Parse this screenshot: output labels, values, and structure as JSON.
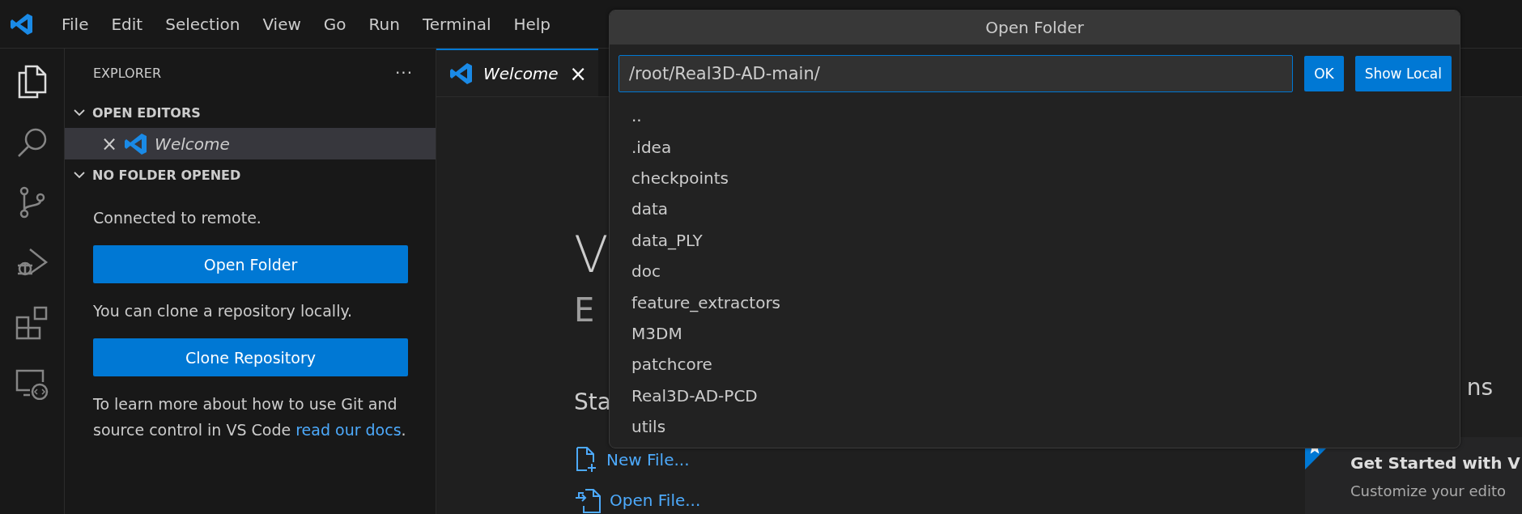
{
  "menu_bar": {
    "items": [
      "File",
      "Edit",
      "Selection",
      "View",
      "Go",
      "Run",
      "Terminal",
      "Help"
    ]
  },
  "activity_bar": {
    "items": [
      {
        "kind": "files",
        "selected": true
      },
      {
        "kind": "search",
        "selected": false
      },
      {
        "kind": "source-control",
        "selected": false
      },
      {
        "kind": "run-debug",
        "selected": false
      },
      {
        "kind": "extensions",
        "selected": false
      },
      {
        "kind": "remote",
        "selected": false
      }
    ]
  },
  "sidebar": {
    "title": "EXPLORER",
    "more": "···",
    "sections": [
      {
        "title": "OPEN EDITORS",
        "expanded": true,
        "items": [
          {
            "close": "×",
            "label": "Welcome",
            "selected": true
          }
        ]
      },
      {
        "title": "NO FOLDER OPENED",
        "expanded": true
      }
    ],
    "message_1": "Connected to remote.",
    "button_1": "Open Folder",
    "message_2": "You can clone a repository locally.",
    "button_2": "Clone Repository",
    "message_3": "To learn more about how to use Git and source control in VS Code ",
    "link": "read our docs",
    "message_3_end": "."
  },
  "tabs": [
    {
      "label": "Welcome",
      "close": "×",
      "selected": true
    }
  ],
  "welcome": {
    "title": "V",
    "subtitle": "E",
    "start_heading": "Sta",
    "right_heading": "ns",
    "actions": [
      {
        "kind": "new-file",
        "label": "New File..."
      },
      {
        "kind": "open-file",
        "label": "Open File..."
      }
    ]
  },
  "notification": {
    "title": "Get Started with V",
    "subtitle": "Customize your edito"
  },
  "dialog": {
    "title": "Open Folder",
    "path": "/root/Real3D-AD-main/",
    "buttons": [
      "OK",
      "Show Local"
    ],
    "entries": [
      "..",
      ".idea",
      "checkpoints",
      "data",
      "data_PLY",
      "doc",
      "feature_extractors",
      "M3DM",
      "patchcore",
      "Real3D-AD-PCD",
      "utils"
    ]
  }
}
